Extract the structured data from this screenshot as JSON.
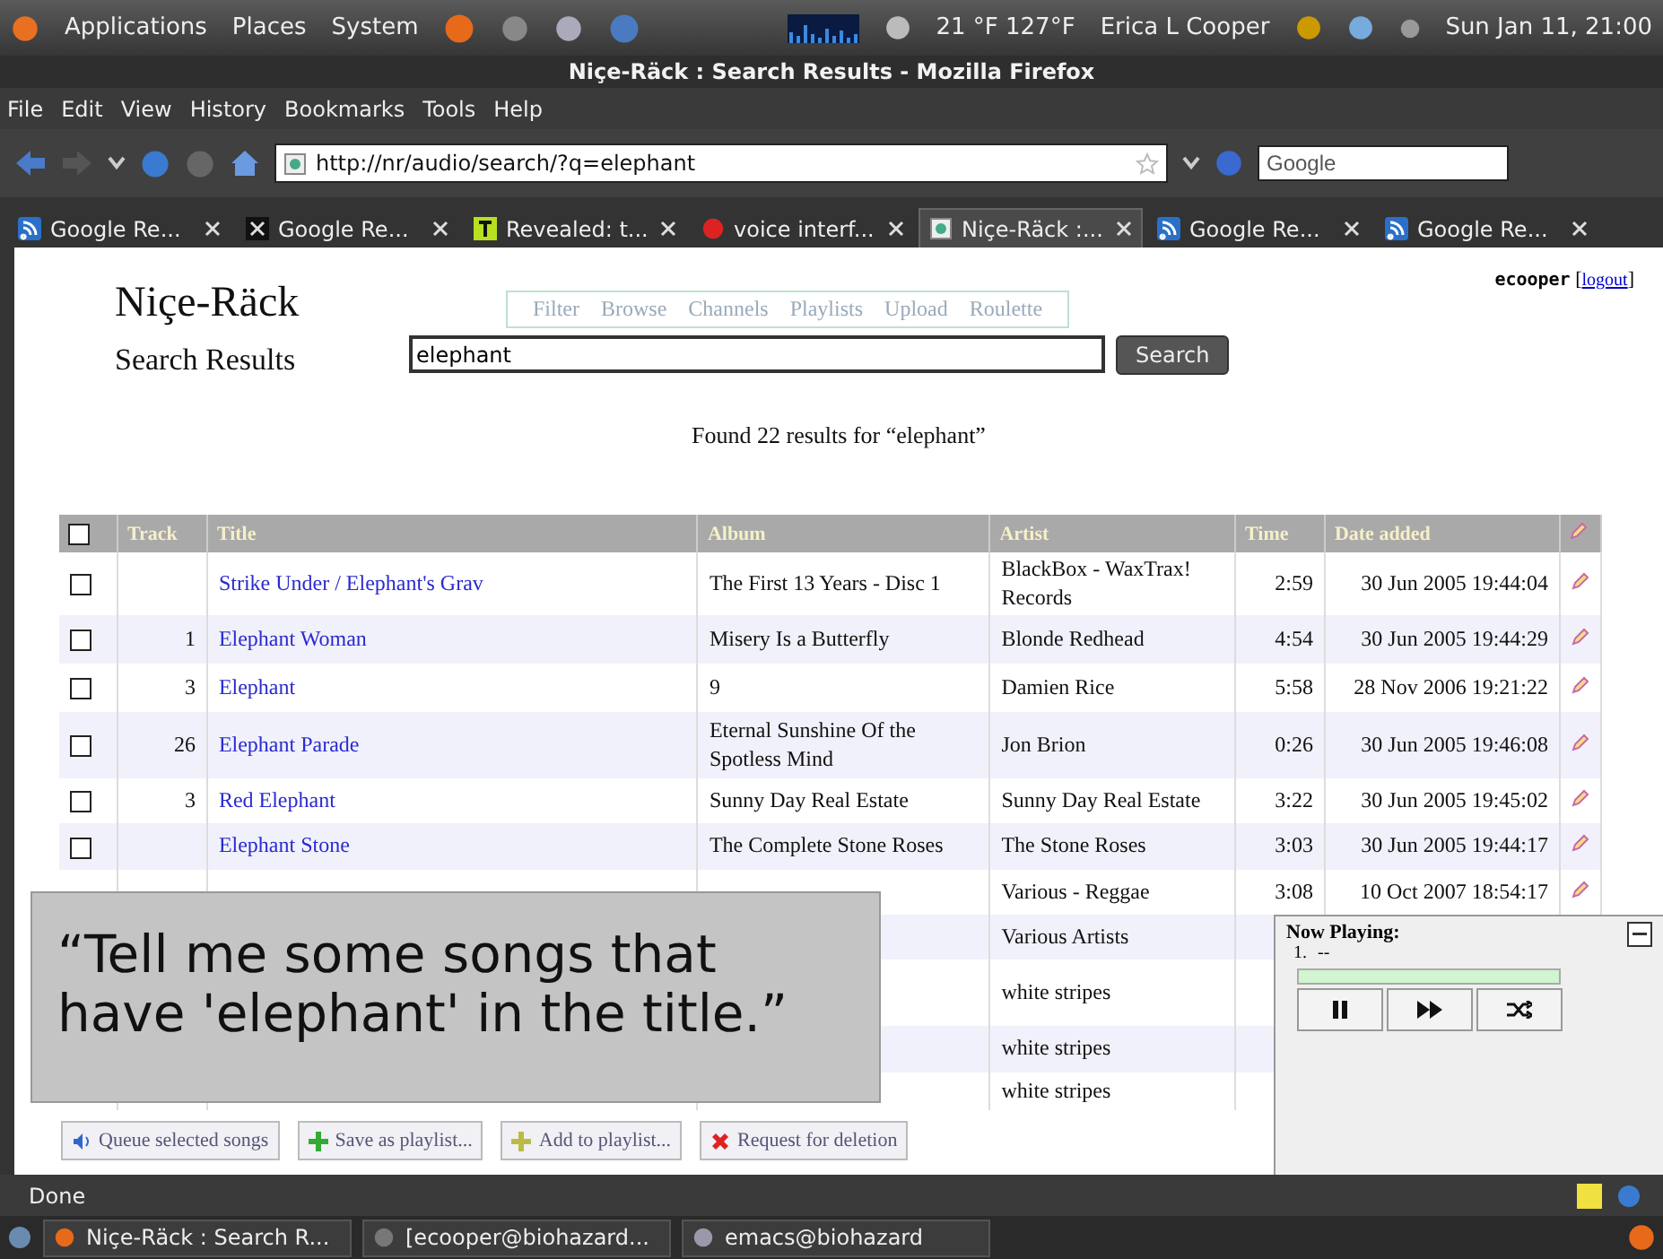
{
  "top_panel": {
    "menus": [
      "Applications",
      "Places",
      "System"
    ],
    "weather": "21 °F 127°F",
    "user": "Erica L Cooper",
    "clock": "Sun Jan 11, 21:00"
  },
  "window": {
    "title": "Niçe-Räck : Search Results - Mozilla Firefox"
  },
  "menu_bar": [
    "File",
    "Edit",
    "View",
    "History",
    "Bookmarks",
    "Tools",
    "Help"
  ],
  "address_bar": {
    "url": "http://nr/audio/search/?q=elephant"
  },
  "search_box": {
    "placeholder": "Google"
  },
  "tabs": [
    {
      "label": "Google Re...",
      "selected": false,
      "kind": "feed"
    },
    {
      "label": "Google Re...",
      "selected": false,
      "kind": "dark"
    },
    {
      "label": "Revealed: t...",
      "selected": false,
      "kind": "letter"
    },
    {
      "label": "voice interf...",
      "selected": false,
      "kind": "red"
    },
    {
      "label": "Niçe-Räck :...",
      "selected": true,
      "kind": "page"
    },
    {
      "label": "Google Re...",
      "selected": false,
      "kind": "feed"
    },
    {
      "label": "Google Re...",
      "selected": false,
      "kind": "feed"
    }
  ],
  "page": {
    "logo": "Niçe-Räck",
    "heading": "Search Results",
    "user": "ecooper",
    "logout": "logout",
    "logout_open": "[",
    "logout_close": "]",
    "nav": [
      "Filter",
      "Browse",
      "Channels",
      "Playlists",
      "Upload",
      "Roulette"
    ],
    "query": "elephant",
    "search_button": "Search",
    "summary": "Found 22 results for “elephant”"
  },
  "table": {
    "columns": [
      "Track",
      "Title",
      "Album",
      "Artist",
      "Time",
      "Date added"
    ],
    "all_checked": false,
    "rows": [
      {
        "checked": false,
        "track": "",
        "title": "Strike Under / Elephant's Grav",
        "album": "The First 13 Years - Disc 1",
        "artist": "BlackBox - WaxTrax! Records",
        "time": "2:59",
        "date": "30 Jun 2005 19:44:04"
      },
      {
        "checked": false,
        "track": "1",
        "title": "Elephant Woman",
        "album": "Misery Is a Butterfly",
        "artist": "Blonde Redhead",
        "time": "4:54",
        "date": "30 Jun 2005 19:44:29"
      },
      {
        "checked": false,
        "track": "3",
        "title": "Elephant",
        "album": "9",
        "artist": "Damien Rice",
        "time": "5:58",
        "date": "28 Nov 2006 19:21:22"
      },
      {
        "checked": false,
        "track": "26",
        "title": "Elephant Parade",
        "album": "Eternal Sunshine Of the Spotless Mind",
        "artist": "Jon Brion",
        "time": "0:26",
        "date": "30 Jun 2005 19:46:08"
      },
      {
        "checked": false,
        "track": "3",
        "title": "Red Elephant",
        "album": "Sunny Day Real Estate",
        "artist": "Sunny Day Real Estate",
        "time": "3:22",
        "date": "30 Jun 2005 19:45:02"
      },
      {
        "checked": false,
        "track": "",
        "title": "Elephant Stone",
        "album": "The Complete Stone Roses",
        "artist": "The Stone Roses",
        "time": "3:03",
        "date": "30 Jun 2005 19:44:17"
      },
      {
        "artist": "Various - Reggae",
        "time": "3:08",
        "date": "10 Oct 2007 18:54:17"
      },
      {
        "artist": "Various Artists"
      },
      {
        "artist": "white stripes"
      },
      {
        "artist": "white stripes"
      },
      {
        "artist": "white stripes"
      }
    ]
  },
  "actions": [
    {
      "label": "Queue selected songs",
      "kind": "speaker"
    },
    {
      "label": "Save as playlist...",
      "kind": "plus"
    },
    {
      "label": "Add to playlist...",
      "kind": "add"
    },
    {
      "label": "Request for deletion",
      "kind": "cross"
    }
  ],
  "caption": "“Tell me some songs that have 'elephant' in the title.”",
  "now_playing": {
    "title": "Now Playing:",
    "number": "1.",
    "track": "--",
    "level": 1
  },
  "status_bar": "Done",
  "taskbar": [
    "Niçe-Räck : Search R...",
    "[ecooper@biohazard...",
    "emacs@biohazard"
  ]
}
